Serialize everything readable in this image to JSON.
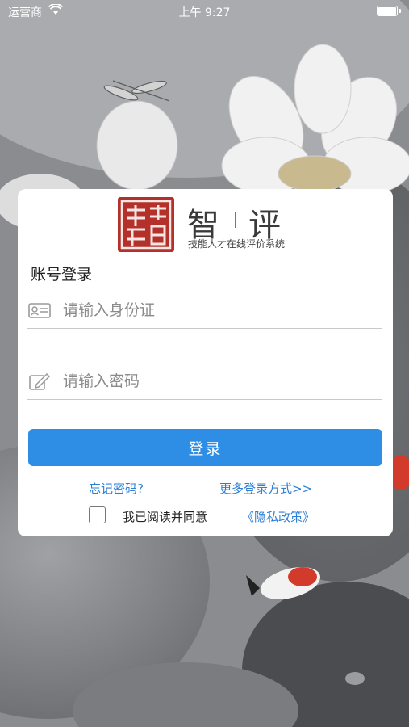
{
  "status_bar": {
    "carrier": "运营商",
    "time": "上午 9:27"
  },
  "logo": {
    "title_left": "智",
    "title_right": "评",
    "subtitle": "技能人才在线评价系统"
  },
  "login": {
    "title": "账号登录",
    "id_placeholder": "请输入身份证",
    "password_placeholder": "请输入密码",
    "submit_label": "登录",
    "forgot_label": "忘记密码?",
    "more_label": "更多登录方式>>",
    "agree_label": "我已阅读并同意",
    "privacy_label": "《隐私政策》"
  },
  "colors": {
    "accent": "#2e8ee6",
    "link": "#2d7fd6",
    "seal": "#b3302b",
    "background": "#6f7174"
  }
}
